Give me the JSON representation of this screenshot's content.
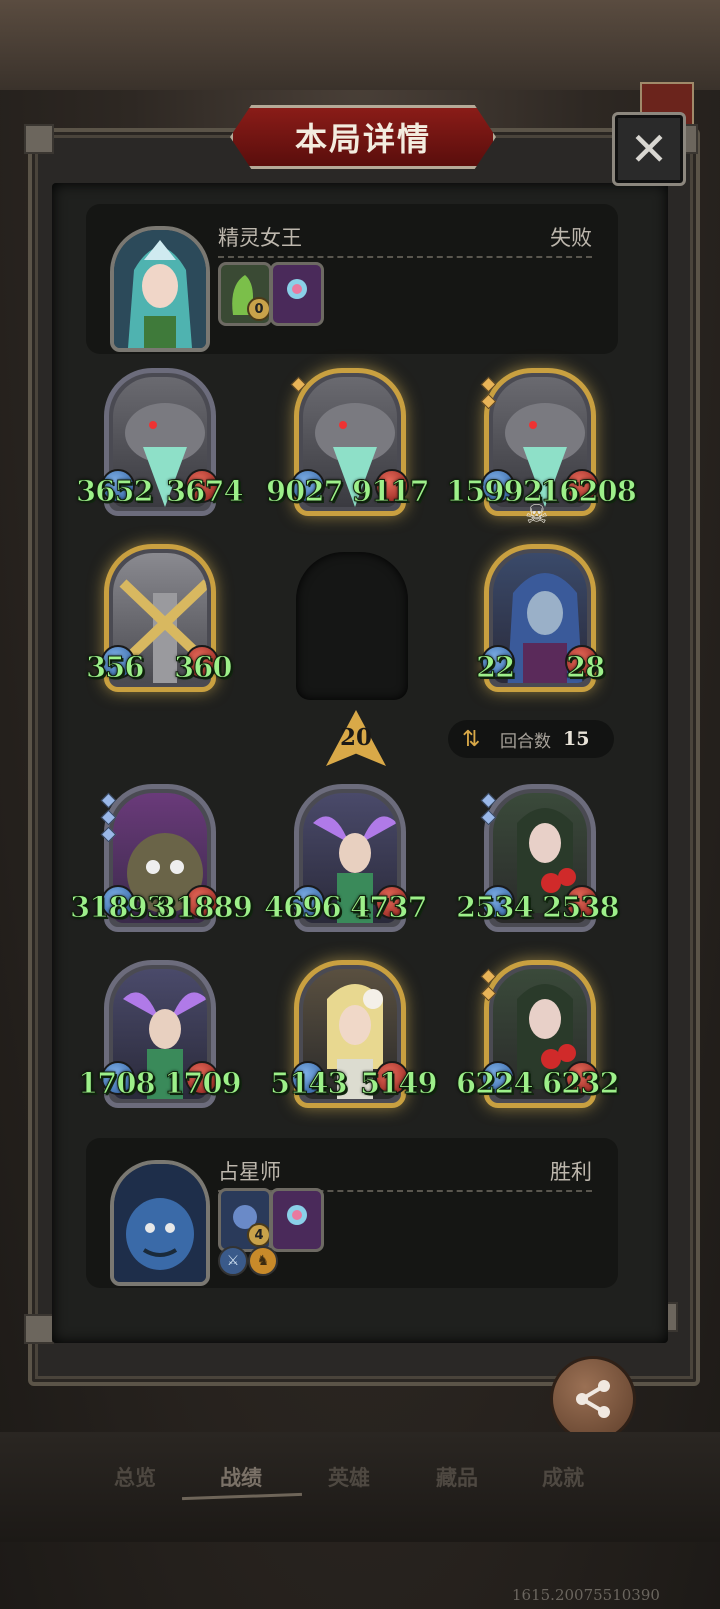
{
  "title": "本局详情",
  "top_player": {
    "name": "精灵女王",
    "result": "失败",
    "slot_badge": "0"
  },
  "bottom_player": {
    "name": "占星师",
    "result": "胜利",
    "slot_badge": "4"
  },
  "opponent_units": [
    {
      "atk": "3652",
      "hp": "3674",
      "tier": "silver"
    },
    {
      "atk": "9027",
      "hp": "9117",
      "tier": "gold"
    },
    {
      "atk": "15992",
      "hp": "16208",
      "tier": "gold"
    },
    {
      "atk": "356",
      "hp": "360",
      "tier": "gold"
    },
    {
      "atk": "22",
      "hp": "28",
      "tier": "gold"
    }
  ],
  "player_units": [
    {
      "atk": "31893",
      "hp": "31889",
      "tier": "silver"
    },
    {
      "atk": "4696",
      "hp": "4737",
      "tier": "silver"
    },
    {
      "atk": "2534",
      "hp": "2538",
      "tier": "silver"
    },
    {
      "atk": "1708",
      "hp": "1709",
      "tier": "silver"
    },
    {
      "atk": "5143",
      "hp": "5149",
      "tier": "gold"
    },
    {
      "atk": "6224",
      "hp": "6232",
      "tier": "gold"
    }
  ],
  "turn_number": "20",
  "round": {
    "label": "回合数",
    "value": "15"
  },
  "share_label": "分享",
  "nav": [
    "总览",
    "战绩",
    "英雄",
    "藏品",
    "成就"
  ],
  "footer": "1615.20075510390",
  "colors": {
    "stat_green": "#9df08a",
    "gold_frame": "#c9a040",
    "banner_red": "#8a1c18"
  }
}
